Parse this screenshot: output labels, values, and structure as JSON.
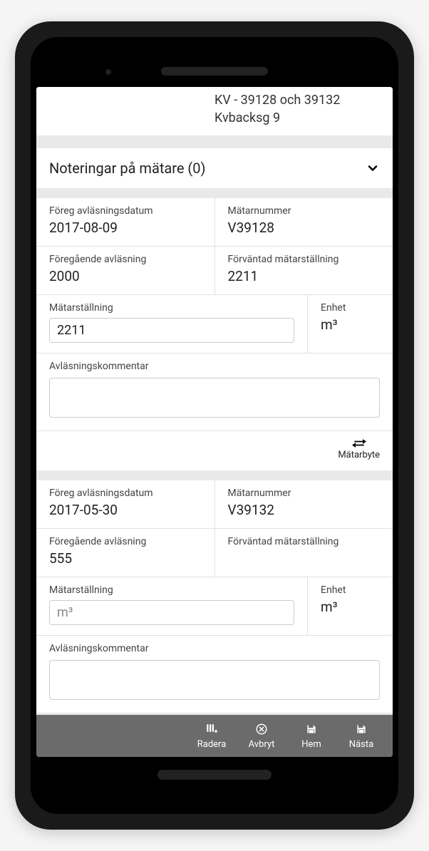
{
  "header": {
    "line1": "KV - 39128 och 39132",
    "line2": "Kvbacksg 9"
  },
  "notes": {
    "title": "Noteringar på mätare (0)"
  },
  "meters": [
    {
      "prev_date_label": "Föreg avläsningsdatum",
      "prev_date_value": "2017-08-09",
      "number_label": "Mätarnummer",
      "number_value": "V39128",
      "prev_reading_label": "Föregående avläsning",
      "prev_reading_value": "2000",
      "expected_label": "Förväntad mätarställning",
      "expected_value": "2211",
      "reading_label": "Mätarställning",
      "reading_value": "2211",
      "reading_placeholder": "",
      "unit_label": "Enhet",
      "unit_value": "m³",
      "comment_label": "Avläsningskommentar",
      "swap_label": "Mätarbyte",
      "show_swap": true
    },
    {
      "prev_date_label": "Föreg avläsningsdatum",
      "prev_date_value": "2017-05-30",
      "number_label": "Mätarnummer",
      "number_value": "V39132",
      "prev_reading_label": "Föregående avläsning",
      "prev_reading_value": "555",
      "expected_label": "Förväntad mätarställning",
      "expected_value": "",
      "reading_label": "Mätarställning",
      "reading_value": "",
      "reading_placeholder": "m³",
      "unit_label": "Enhet",
      "unit_value": "m³",
      "comment_label": "Avläsningskommentar",
      "swap_label": "Mätarbyte",
      "show_swap": false
    }
  ],
  "nav": {
    "radera": "Radera",
    "avbryt": "Avbryt",
    "hem": "Hem",
    "nasta": "Nästa"
  }
}
